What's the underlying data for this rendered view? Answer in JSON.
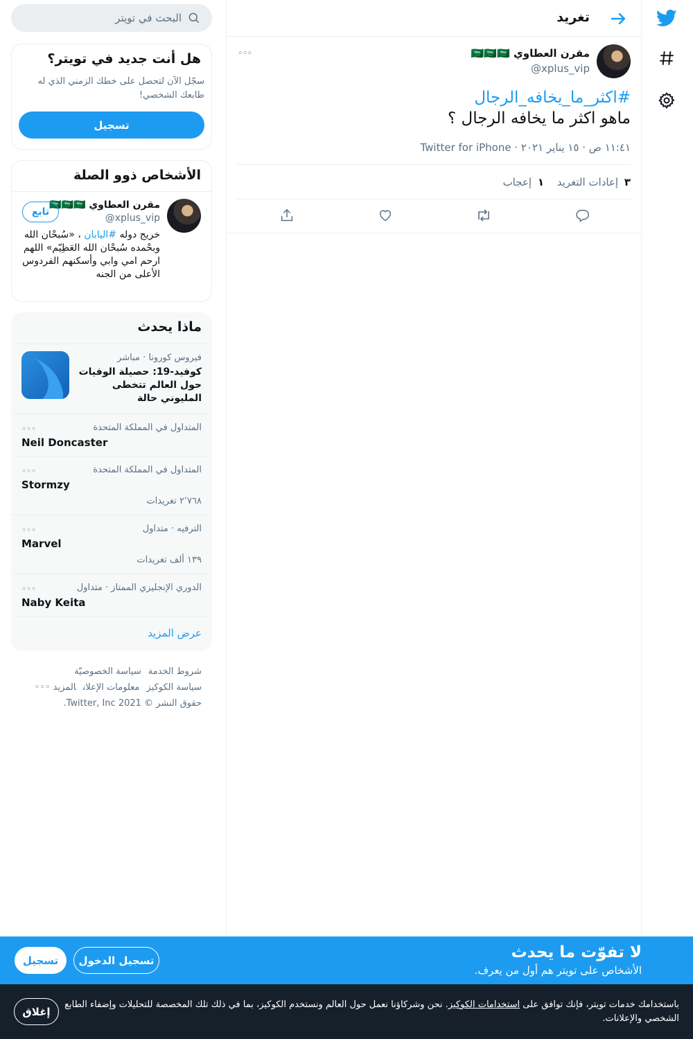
{
  "nav": {
    "logo_icon": "twitter-bird-icon",
    "explore_icon": "hashtag-icon",
    "settings_icon": "gear-icon"
  },
  "header": {
    "title": "تغريد",
    "back_icon": "arrow-right-icon"
  },
  "tweet": {
    "author_name": "مقرن العطاوي 🇸🇦🇸🇦🇸🇦",
    "author_handle": "@xplus_vip",
    "hashtag": "#اكثر_ما_يخافه_الرجال",
    "text": "ماهو اكثر ما يخافه الرجال ؟",
    "meta": "١١:٤١ ص · ١٥ يناير ٢٠٢١ · Twitter for iPhone",
    "retweets_count": "٣",
    "retweets_label": "إعادات التغريد",
    "likes_count": "١",
    "likes_label": "إعجاب"
  },
  "actions": [
    "reply-icon",
    "retweet-icon",
    "like-icon",
    "share-icon"
  ],
  "search": {
    "placeholder": "البحث في تويتر"
  },
  "new_card": {
    "title": "هل أنت جديد في تويتر؟",
    "description": "سجّل الآن لتحصل على خطك الزمني الذي له طابعك الشخصي!",
    "signup_label": "تسجيل"
  },
  "related": {
    "title": "الأشخاص ذوو الصلة",
    "name": "مقرن العطاوي 🇸🇦🇸🇦🇸🇦",
    "handle": "@xplus_vip",
    "follow_label": "تابع",
    "bio_pre": "خريج دوله ",
    "bio_link": "#اليابان",
    "bio_post": " ، «سُبحْان الله وبحْمده سُبحْان الله العَظِيّم» اللهم ارحم امي وابي وأسكنهم الفردوس الأعلى من الجنه"
  },
  "trends": {
    "title": "ماذا يحدث",
    "featured": {
      "context": "فيروس كورونا · مباشر",
      "headline": "كوفيد-19: حصيلة الوفيات حول العالم تتخطى المليوني حالة"
    },
    "items": [
      {
        "context": "المتداول في المملكة المتحدة",
        "name": "Neil Doncaster",
        "count": ""
      },
      {
        "context": "المتداول في المملكة المتحدة",
        "name": "Stormzy",
        "count": "٢٬٧٦٨ تغريدات"
      },
      {
        "context": "الترفيه · متداول",
        "name": "Marvel",
        "count": "١٣٩ ألف تغريدات"
      },
      {
        "context": "الدوري الإنجليزي الممتاز · متداول",
        "name": "Naby Keita",
        "count": ""
      }
    ],
    "show_more": "عرض المزيد"
  },
  "footer": {
    "terms": "شروط الخدمة",
    "privacy": "سياسة الخصوصيّة",
    "cookies": "سياسة الكوكيز",
    "ads": "معلومات الإعلان",
    "more": "المزيد ◦◦◦",
    "copyright": "حقوق النشر © 2021 Twitter, Inc."
  },
  "banner": {
    "title": "لا تفوّت ما يحدث",
    "subtitle": "الأشخاص على تويتر هم أول من يعرف.",
    "login_label": "تسجيل الدخول",
    "signup_label": "تسجيل"
  },
  "cookie": {
    "text_pre": "باستخدامك خدمات تويتر، فإنك توافق على ",
    "link": "استخدامات الكوكيز",
    "text_post": ". نحن وشركاؤنا نعمل حول العالم ونستخدم الكوكيز، بما في ذلك تلك المخصصة للتحليلات وإضفاء الطابع الشخصي والإعلانات.",
    "close_label": "إغلاق"
  },
  "colors": {
    "accent": "#1d9bf0",
    "text": "#0f1419",
    "muted": "#5b7083",
    "cookie_bg": "#15202b"
  }
}
